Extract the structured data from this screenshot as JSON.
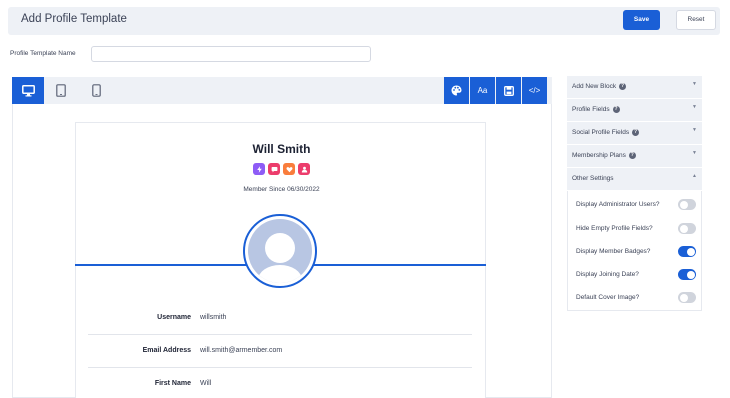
{
  "header": {
    "title": "Add Profile Template",
    "save_label": "Save",
    "reset_label": "Reset"
  },
  "template_name": {
    "label": "Profile Template Name",
    "value": "",
    "placeholder": ""
  },
  "toolbar": {
    "devices": [
      "desktop-icon",
      "tablet-icon",
      "mobile-icon"
    ],
    "tools": [
      "palette-icon",
      "font-icon",
      "save-icon",
      "code-icon"
    ],
    "font_glyph": "Aa",
    "code_glyph": "</>"
  },
  "profile": {
    "name": "Will Smith",
    "badges": [
      {
        "icon": "bolt-icon",
        "color": "#8e5cf6"
      },
      {
        "icon": "chat-icon",
        "color": "#ec3d6c"
      },
      {
        "icon": "heart-icon",
        "color": "#f97d3c"
      },
      {
        "icon": "user-icon",
        "color": "#ec3d6c"
      }
    ],
    "member_since": "Member Since 06/30/2022",
    "fields": [
      {
        "label": "Username",
        "value": "willsmith"
      },
      {
        "label": "Email Address",
        "value": "will.smith@armember.com"
      },
      {
        "label": "First Name",
        "value": "Will"
      }
    ]
  },
  "panel": {
    "sections": [
      {
        "label": "Add New Block",
        "caret": "▼"
      },
      {
        "label": "Profile Fields",
        "caret": "▼"
      },
      {
        "label": "Social Profile Fields",
        "caret": "▼"
      },
      {
        "label": "Membership Plans",
        "caret": "▼"
      },
      {
        "label": "Other Settings",
        "caret": "▲"
      }
    ],
    "other_settings": [
      {
        "label": "Display Administrator Users?",
        "on": false
      },
      {
        "label": "Hide Empty Profile Fields?",
        "on": false
      },
      {
        "label": "Display Member Badges?",
        "on": true
      },
      {
        "label": "Display Joining Date?",
        "on": true
      },
      {
        "label": "Default Cover Image?",
        "on": false
      }
    ]
  },
  "colors": {
    "accent": "#1a5fd6",
    "bar": "#eef1f6"
  }
}
